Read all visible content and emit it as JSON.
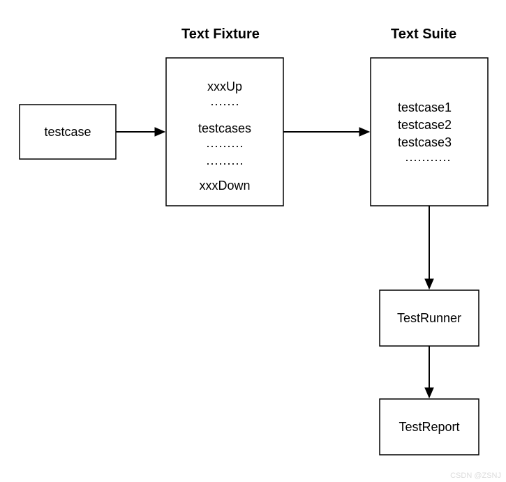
{
  "titles": {
    "fixture": "Text Fixture",
    "suite": "Text Suite"
  },
  "boxes": {
    "testcase": {
      "lines": [
        "testcase"
      ]
    },
    "fixture": {
      "lines": [
        "xxxUp",
        "·······",
        "testcases",
        "·········",
        "·········",
        "xxxDown"
      ]
    },
    "suite": {
      "lines": [
        "testcase1",
        "testcase2",
        "testcase3",
        "···········"
      ]
    },
    "runner": {
      "lines": [
        "TestRunner"
      ]
    },
    "report": {
      "lines": [
        "TestReport"
      ]
    }
  },
  "watermark": "CSDN @ZSNJ"
}
